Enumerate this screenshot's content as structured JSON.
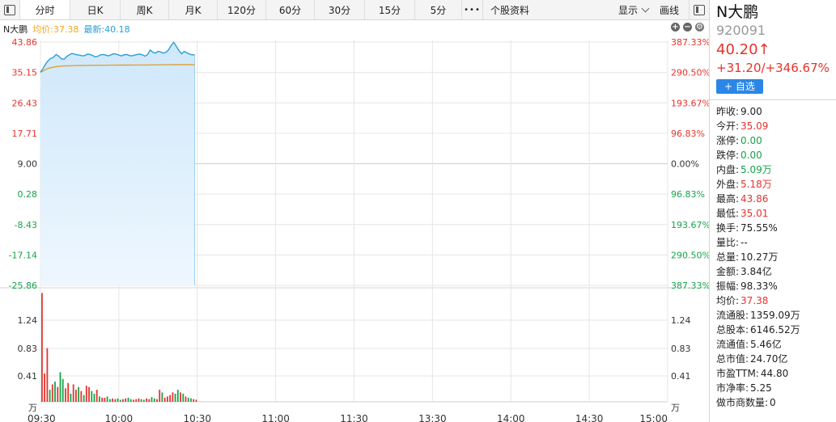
{
  "toolbar": {
    "tabs": [
      {
        "label": "分时",
        "active": true,
        "w": 62
      },
      {
        "label": "日K",
        "active": false,
        "w": 62
      },
      {
        "label": "周K",
        "active": false,
        "w": 60
      },
      {
        "label": "月K",
        "active": false,
        "w": 60
      },
      {
        "label": "120分",
        "active": false,
        "w": 60
      },
      {
        "label": "60分",
        "active": false,
        "w": 60
      },
      {
        "label": "30分",
        "active": false,
        "w": 62
      },
      {
        "label": "15分",
        "active": false,
        "w": 62
      },
      {
        "label": "5分",
        "active": false,
        "w": 58
      }
    ],
    "more": "•••",
    "info": "个股资料",
    "display": "显示",
    "draw": "画线"
  },
  "legend": {
    "name": "N大鹏",
    "avg": "均价:37.38",
    "last": "最新:40.18"
  },
  "chart_data": {
    "type": "line",
    "price_axis_left": [
      "43.86",
      "35.15",
      "26.43",
      "17.71",
      "9.00",
      "0.28",
      "-8.43",
      "-17.14",
      "-25.86"
    ],
    "pct_axis_right": [
      "387.33%",
      "290.50%",
      "193.67%",
      "96.83%",
      "0.00%",
      "96.83%",
      "193.67%",
      "290.50%",
      "387.33%"
    ],
    "volume_axis": [
      "1.24",
      "0.83",
      "0.41",
      "万"
    ],
    "time_labels": [
      "09:30",
      "10:00",
      "10:30",
      "11:00",
      "11:30",
      "13:30",
      "14:00",
      "14:30",
      "15:00"
    ],
    "pre_close": 9.0,
    "ylim": [
      -25.86,
      43.86
    ],
    "volume_ylim": [
      0,
      1.65
    ],
    "price": [
      35.2,
      36.3,
      37.6,
      38.6,
      39.2,
      39.5,
      40.3,
      39.8,
      39.1,
      38.9,
      39.7,
      40.2,
      40.6,
      40.4,
      40.2,
      40.1,
      39.9,
      40.0,
      40.4,
      40.3,
      40.0,
      39.6,
      39.8,
      40.2,
      40.3,
      40.1,
      39.9,
      40.2,
      40.5,
      40.4,
      40.1,
      39.9,
      40.2,
      40.3,
      40.0,
      39.9,
      40.1,
      40.3,
      40.4,
      40.2,
      39.8,
      40.3,
      41.6,
      40.9,
      40.7,
      41.2,
      41.0,
      40.7,
      40.9,
      41.6,
      42.9,
      43.8,
      42.6,
      41.4,
      40.5,
      41.2,
      40.8,
      40.4,
      40.2,
      40.2
    ],
    "avg": [
      35.2,
      35.6,
      36.0,
      36.3,
      36.5,
      36.7,
      36.8,
      36.9,
      36.95,
      37.0,
      37.02,
      37.05,
      37.07,
      37.1,
      37.12,
      37.14,
      37.15,
      37.16,
      37.17,
      37.18,
      37.19,
      37.2,
      37.2,
      37.21,
      37.22,
      37.22,
      37.23,
      37.23,
      37.24,
      37.24,
      37.25,
      37.25,
      37.26,
      37.26,
      37.27,
      37.27,
      37.28,
      37.28,
      37.29,
      37.29,
      37.29,
      37.3,
      37.31,
      37.32,
      37.32,
      37.33,
      37.33,
      37.34,
      37.34,
      37.35,
      37.36,
      37.37,
      37.37,
      37.37,
      37.37,
      37.38,
      37.38,
      37.38,
      37.38,
      37.38
    ],
    "volume": [
      1.62,
      0.42,
      0.8,
      0.18,
      0.26,
      0.3,
      0.22,
      0.44,
      0.34,
      0.2,
      0.28,
      0.12,
      0.26,
      0.18,
      0.22,
      0.16,
      0.1,
      0.24,
      0.22,
      0.16,
      0.12,
      0.18,
      0.08,
      0.06,
      0.06,
      0.08,
      0.04,
      0.05,
      0.04,
      0.05,
      0.03,
      0.04,
      0.05,
      0.06,
      0.04,
      0.03,
      0.04,
      0.05,
      0.04,
      0.03,
      0.05,
      0.04,
      0.07,
      0.05,
      0.04,
      0.18,
      0.14,
      0.06,
      0.08,
      0.1,
      0.14,
      0.12,
      0.18,
      0.14,
      0.12,
      0.08,
      0.06,
      0.05,
      0.04,
      0.03
    ],
    "volume_dir": [
      "u",
      "u",
      "u",
      "d",
      "u",
      "d",
      "u",
      "d",
      "d",
      "u",
      "u",
      "d",
      "u",
      "u",
      "d",
      "u",
      "d",
      "u",
      "u",
      "d",
      "d",
      "u",
      "d",
      "u",
      "u",
      "d",
      "d",
      "u",
      "u",
      "d",
      "d",
      "u",
      "u",
      "d",
      "d",
      "u",
      "u",
      "u",
      "d",
      "d",
      "u",
      "u",
      "d",
      "d",
      "u",
      "u",
      "d",
      "u",
      "u",
      "u",
      "u",
      "d",
      "d",
      "u",
      "d",
      "u",
      "d",
      "d",
      "u",
      "u"
    ]
  },
  "stock": {
    "name": "N大鹏",
    "code": "920091",
    "price": "40.20↑",
    "change": "+31.20/+346.67%",
    "add_label": "+ 自选"
  },
  "quotes": [
    {
      "label": "昨收:",
      "value": "9.00",
      "tone": "blk"
    },
    {
      "label": "今开:",
      "value": "35.09",
      "tone": "red"
    },
    {
      "label": "涨停:",
      "value": "0.00",
      "tone": "green"
    },
    {
      "label": "跌停:",
      "value": "0.00",
      "tone": "green"
    },
    {
      "label": "内盘:",
      "value": "5.09万",
      "tone": "green"
    },
    {
      "label": "外盘:",
      "value": "5.18万",
      "tone": "red"
    },
    {
      "label": "最高:",
      "value": "43.86",
      "tone": "red"
    },
    {
      "label": "最低:",
      "value": "35.01",
      "tone": "red"
    },
    {
      "label": "换手:",
      "value": "75.55%",
      "tone": "blk"
    },
    {
      "label": "量比:",
      "value": "--",
      "tone": "blk"
    },
    {
      "label": "总量:",
      "value": "10.27万",
      "tone": "blk"
    },
    {
      "label": "金额:",
      "value": "3.84亿",
      "tone": "blk"
    },
    {
      "label": "振幅:",
      "value": "98.33%",
      "tone": "blk"
    },
    {
      "label": "均价:",
      "value": "37.38",
      "tone": "red"
    },
    {
      "label": "流通股:",
      "value": "1359.09万",
      "tone": "blk"
    },
    {
      "label": "总股本:",
      "value": "6146.52万",
      "tone": "blk"
    },
    {
      "label": "流通值:",
      "value": "5.46亿",
      "tone": "blk"
    },
    {
      "label": "总市值:",
      "value": "24.70亿",
      "tone": "blk"
    },
    {
      "label": "市盈TTM:",
      "value": "44.80",
      "tone": "blk"
    },
    {
      "label": "市净率:",
      "value": "5.25",
      "tone": "blk"
    },
    {
      "label": "做市商数量:",
      "value": "0",
      "tone": "blk"
    }
  ],
  "colors": {
    "up": "#e8322b",
    "down": "#16a34a",
    "price_line": "#2a9fd6",
    "avg_line": "#e0a23a",
    "grid": "#e6e6e6",
    "accent": "#2b86e6"
  }
}
